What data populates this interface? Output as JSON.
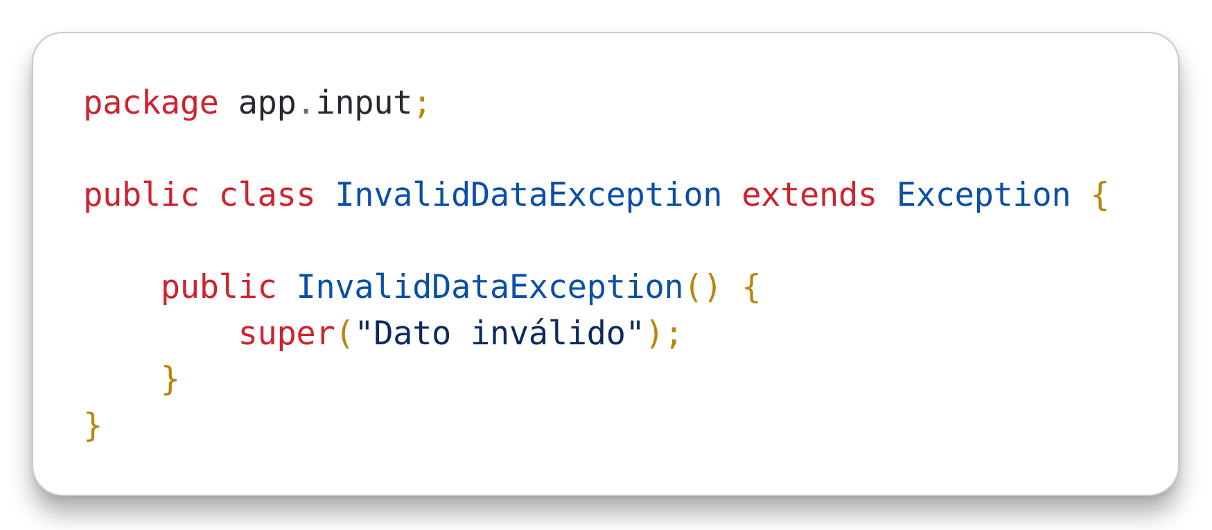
{
  "code": {
    "line1": {
      "kw_package": "package",
      "pkg_first": "app",
      "dot": ".",
      "pkg_second": "input",
      "semicolon": ";"
    },
    "line3": {
      "kw_public": "public",
      "kw_class": "class",
      "class_name": "InvalidDataException",
      "kw_extends": "extends",
      "parent_class": "Exception",
      "open_brace": "{"
    },
    "line5": {
      "kw_public": "public",
      "ctor_name": "InvalidDataException",
      "parens": "()",
      "open_brace": "{"
    },
    "line6": {
      "kw_super": "super",
      "open_paren": "(",
      "string_literal": "\"Dato inválido\"",
      "close": ");"
    },
    "line7": {
      "close_brace": "}"
    },
    "line8": {
      "close_brace": "}"
    }
  },
  "colors": {
    "keyword": "#cf222e",
    "type": "#0a4fa8",
    "punctuation": "#b8860b",
    "plain": "#24292f",
    "string": "#0b2a5a"
  }
}
